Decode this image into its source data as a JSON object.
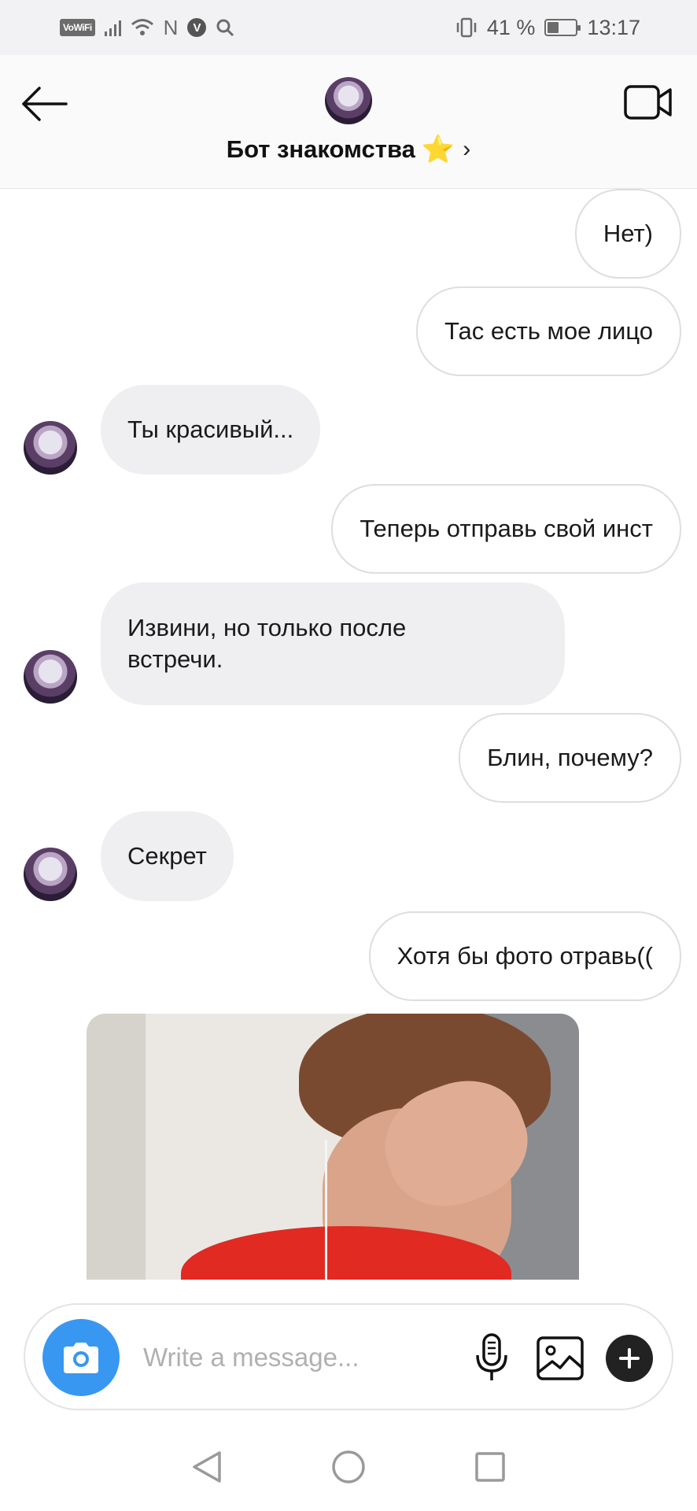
{
  "status_bar": {
    "vowifi": "VoWiFi",
    "nfc": "N",
    "vpn": "V",
    "battery": "41 %",
    "battery_level": 0.41,
    "time": "13:17"
  },
  "header": {
    "title": "Бот знакомства",
    "title_emoji": "⭐",
    "chevron": "›",
    "icons": {
      "back": "back-arrow-icon",
      "video": "video-call-icon"
    }
  },
  "messages": [
    {
      "side": "out",
      "text": "Нет)"
    },
    {
      "side": "out",
      "text": "Тас есть мое лицо"
    },
    {
      "side": "in",
      "text": "Ты красивый..."
    },
    {
      "side": "out",
      "text": "Теперь отправь свой инст"
    },
    {
      "side": "in",
      "text": "Извини, но только после\nвстречи."
    },
    {
      "side": "out",
      "text": "Блин, почему?"
    },
    {
      "side": "in",
      "text": "Секрет"
    },
    {
      "side": "out",
      "text": "Хотя бы фото отравь(("
    }
  ],
  "composer": {
    "placeholder": "Write a message...",
    "icons": [
      "camera-icon",
      "microphone-icon",
      "gallery-icon",
      "plus-icon"
    ]
  },
  "nav_bar": {
    "icons": [
      "nav-back-icon",
      "nav-home-icon",
      "nav-recents-icon"
    ]
  },
  "colors": {
    "accent": "#3897f0",
    "incoming_bubble": "#efeff1",
    "outgoing_border": "#dedede",
    "star": "#f7c21b"
  }
}
